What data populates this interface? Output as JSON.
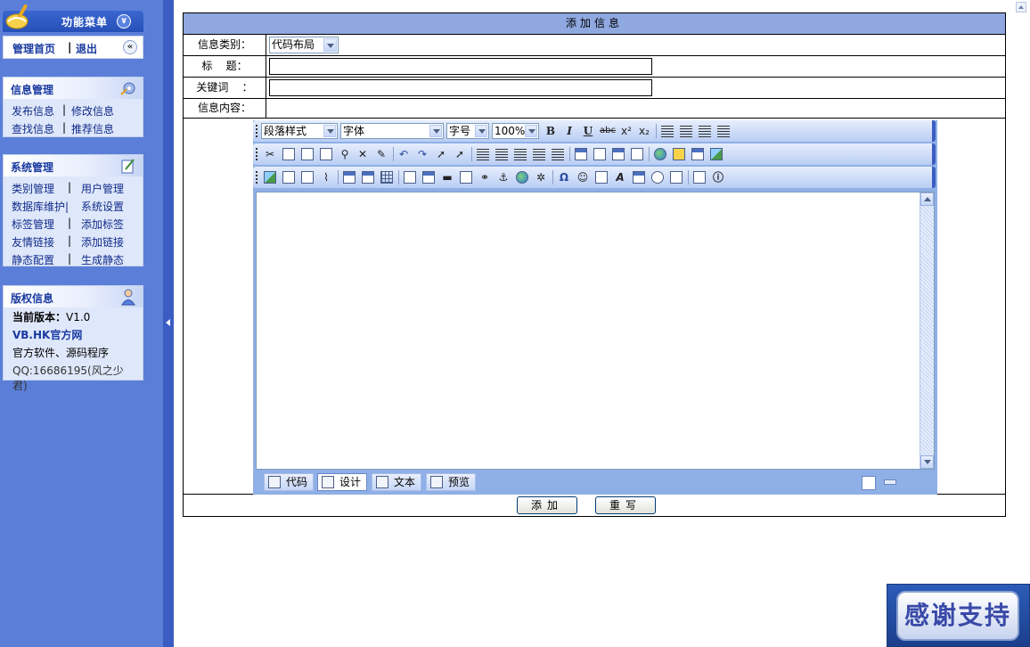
{
  "sidebar": {
    "menu_title": "功能菜单",
    "home_link": "管理首页",
    "separator": "|",
    "logout_link": "退出",
    "info_mgmt": {
      "title": "信息管理",
      "items": [
        "发布信息",
        "修改信息",
        "查找信息",
        "推荐信息"
      ]
    },
    "sys_mgmt": {
      "title": "系统管理",
      "items": [
        "类别管理",
        "用户管理",
        "数据库维护|",
        "系统设置",
        "标签管理",
        "添加标签",
        "友情链接",
        "添加链接",
        "静态配置",
        "生成静态"
      ]
    },
    "copyright": {
      "title": "版权信息",
      "version_label": "当前版本：",
      "version_value": "V1.0",
      "site": "VB.HK官方网",
      "desc": "官方软件、源码程序",
      "qq": "QQ:16686195(风之少君)"
    }
  },
  "form": {
    "header": "添加信息",
    "category_label": "信息类别：",
    "category_value": "代码布局",
    "title_label": "标    题：",
    "title_value": "",
    "keyword_label": "关键词    ：",
    "keyword_value": "",
    "content_label": "信息内容：",
    "submit_label": "添加",
    "reset_label": "重写"
  },
  "editor": {
    "paragraph_style": "段落样式",
    "font": "字体",
    "font_size": "字号",
    "zoom": "100%",
    "format_buttons": [
      "B",
      "I",
      "U",
      "abc",
      "x²",
      "x₂"
    ],
    "modes": [
      "代码",
      "设计",
      "文本",
      "预览"
    ],
    "active_mode": "设计"
  },
  "badge": {
    "thanks": "感谢支持"
  },
  "colors": {
    "sidebar_bg": "#5b7fd9",
    "header_bg": "#8fa8e0",
    "toolbar_bg": "#b9cdf4"
  }
}
